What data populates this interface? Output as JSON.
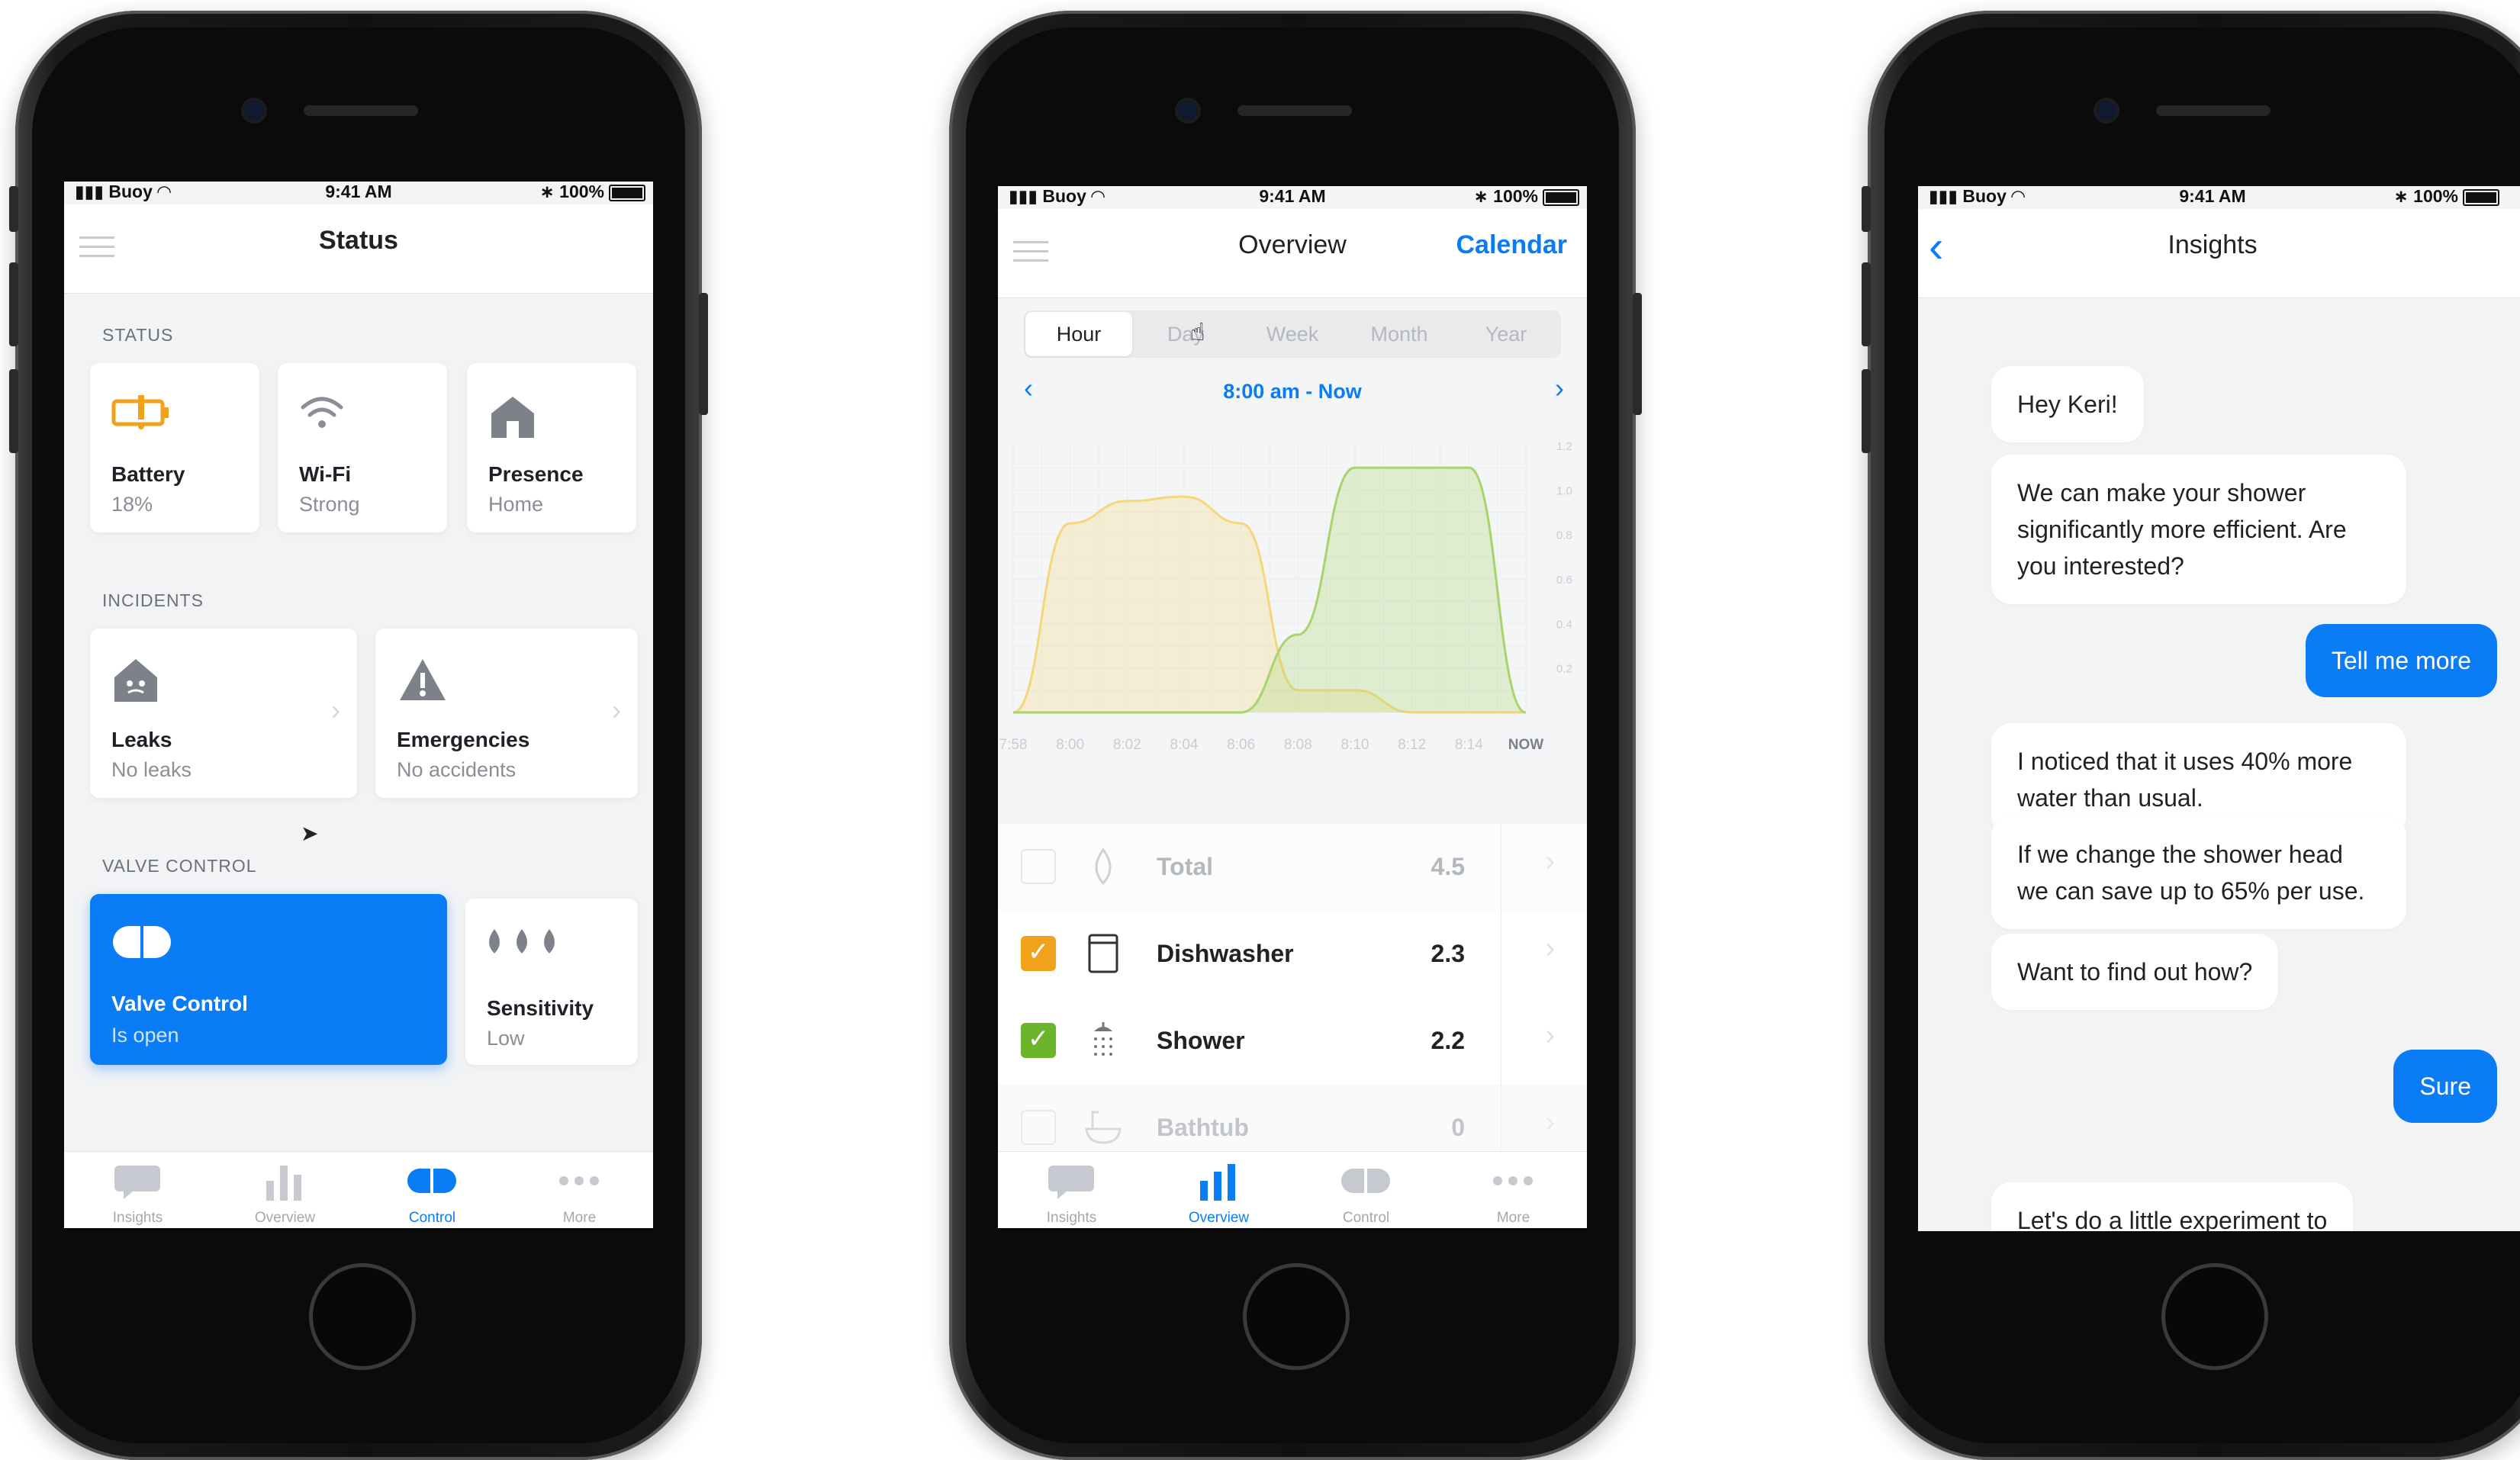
{
  "status_bar": {
    "carrier": "Buoy",
    "time": "9:41 AM",
    "battery": "100%"
  },
  "phone1": {
    "title": "Status",
    "sections": {
      "status": "STATUS",
      "incidents": "INCIDENTS",
      "valve": "VALVE CONTROL"
    },
    "status_cards": [
      {
        "title": "Battery",
        "sub": "18%",
        "icon": "battery-low-icon"
      },
      {
        "title": "Wi-Fi",
        "sub": "Strong",
        "icon": "wifi-icon"
      },
      {
        "title": "Presence",
        "sub": "Home",
        "icon": "house-icon"
      }
    ],
    "incident_cards": [
      {
        "title": "Leaks",
        "sub": "No leaks",
        "icon": "house-drop-icon"
      },
      {
        "title": "Emergencies",
        "sub": "No accidents",
        "icon": "warning-icon"
      }
    ],
    "valve_card": {
      "title": "Valve Control",
      "sub": "Is open",
      "icon": "toggle-icon"
    },
    "sensitivity_card": {
      "title": "Sensitivity",
      "sub": "Low",
      "icon": "drops-icon"
    },
    "active_tab": "Control"
  },
  "tabs": [
    "Insights",
    "Overview",
    "Control",
    "More"
  ],
  "phone2": {
    "title": "Overview",
    "calendar": "Calendar",
    "ranges": [
      "Hour",
      "Day",
      "Week",
      "Month",
      "Year"
    ],
    "selected_range": "Hour",
    "period": "8:00 am - Now",
    "active_tab": "Overview",
    "rows": [
      {
        "name": "Total",
        "value": "4.5",
        "checked": false,
        "check_color": "",
        "icon": "drop-icon"
      },
      {
        "name": "Dishwasher",
        "value": "2.3",
        "checked": true,
        "check_color": "#f0a21b",
        "icon": "dishwasher-icon"
      },
      {
        "name": "Shower",
        "value": "2.2",
        "checked": true,
        "check_color": "#6ab52c",
        "icon": "shower-icon"
      },
      {
        "name": "Bathtub",
        "value": "0",
        "checked": false,
        "check_color": "",
        "icon": "bathtub-icon"
      }
    ]
  },
  "chart_data": {
    "type": "area",
    "x": [
      "7:58",
      "8:00",
      "8:02",
      "8:04",
      "8:06",
      "8:08",
      "8:10",
      "8:12",
      "8:14",
      "NOW"
    ],
    "y_ticks": [
      "1.2",
      "1.0",
      "0.8",
      "0.6",
      "0.4",
      "0.2"
    ],
    "ylim": [
      0,
      1.2
    ],
    "series": [
      {
        "color": "#f5d77a",
        "values": [
          0,
          0.85,
          0.95,
          0.97,
          0.85,
          0.1,
          0.1,
          0,
          0,
          0
        ]
      },
      {
        "color": "#a7d46b",
        "values": [
          0,
          0,
          0,
          0,
          0,
          0.35,
          1.1,
          1.1,
          1.1,
          0
        ]
      }
    ]
  },
  "phone3": {
    "title": "Insights",
    "messages": [
      {
        "from": "bot",
        "text": "Hey Keri!"
      },
      {
        "from": "bot",
        "text": "We can make your shower significantly more efficient. Are you interested?"
      },
      {
        "from": "user",
        "text": "Tell me more"
      },
      {
        "from": "bot",
        "text": "I noticed that it uses 40% more water than usual."
      },
      {
        "from": "bot",
        "text": "If we change the shower head we can save up to 65% per use."
      },
      {
        "from": "bot",
        "text": "Want to find out how?"
      },
      {
        "from": "user",
        "text": "Sure"
      },
      {
        "from": "bot",
        "text": "Let's do a little experiment to"
      }
    ]
  }
}
